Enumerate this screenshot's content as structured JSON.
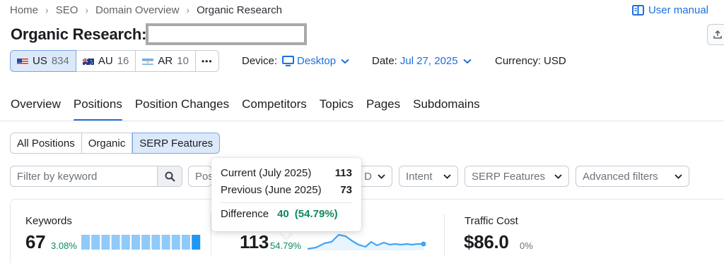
{
  "breadcrumb": [
    "Home",
    "SEO",
    "Domain Overview",
    "Organic Research"
  ],
  "user_manual": "User manual",
  "title": "Organic Research:",
  "db_tabs": [
    {
      "code": "US",
      "count": "834",
      "active": true
    },
    {
      "code": "AU",
      "count": "16",
      "active": false
    },
    {
      "code": "AR",
      "count": "10",
      "active": false
    }
  ],
  "more_label": "•••",
  "device": {
    "label": "Device:",
    "value": "Desktop"
  },
  "date": {
    "label": "Date:",
    "value": "Jul 27, 2025"
  },
  "currency": {
    "label": "Currency:",
    "value": "USD"
  },
  "main_tabs": [
    "Overview",
    "Positions",
    "Position Changes",
    "Competitors",
    "Topics",
    "Pages",
    "Subdomains"
  ],
  "active_main_tab": "Positions",
  "segments": [
    "All Positions",
    "Organic",
    "SERP Features"
  ],
  "active_segment": "SERP Features",
  "filters": {
    "keyword_placeholder": "Filter by keyword",
    "positions_partial": "Pos",
    "partial_d": "D",
    "intent": "Intent",
    "serp_features": "SERP Features",
    "advanced": "Advanced filters"
  },
  "metrics": {
    "keywords": {
      "label": "Keywords",
      "value": "67",
      "change": "3.08%"
    },
    "traffic": {
      "value": "113",
      "change": "54.79%"
    },
    "traffic_cost": {
      "label": "Traffic Cost",
      "value": "$86.0",
      "change": "0%"
    }
  },
  "tooltip": {
    "current_label": "Current (July 2025)",
    "current_value": "113",
    "previous_label": "Previous (June 2025)",
    "previous_value": "73",
    "difference_label": "Difference",
    "difference_value": "40",
    "difference_pct": "(54.79%)"
  },
  "colors": {
    "accent": "#1d6fe0",
    "green": "#0c8b5a",
    "spark": "#42a5f5"
  }
}
